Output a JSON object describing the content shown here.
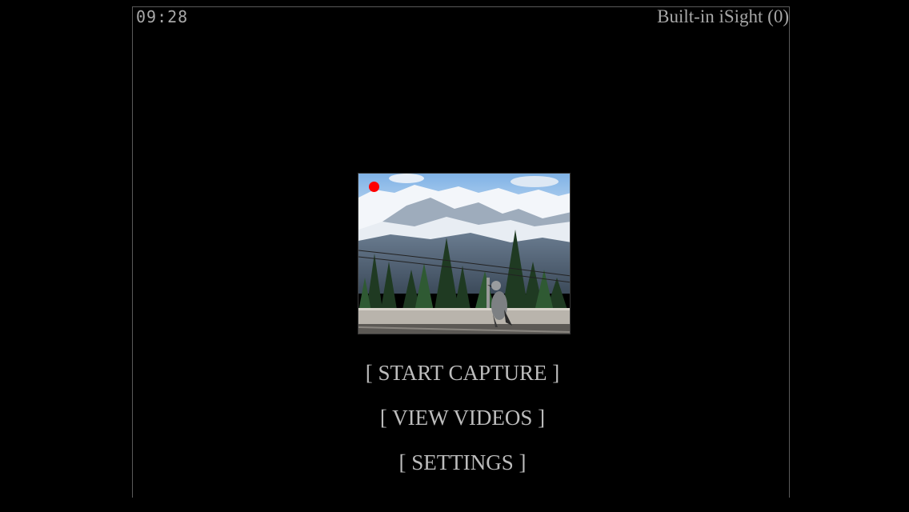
{
  "status": {
    "time": "09:28",
    "camera": "Built-in iSight (0)"
  },
  "preview": {
    "recording_indicator_color": "#ff0000",
    "icon": "camera-preview-image"
  },
  "menu": {
    "start_capture": "[ START CAPTURE ]",
    "view_videos": "[ VIEW VIDEOS ]",
    "settings": "[ SETTINGS ]"
  },
  "colors": {
    "background": "#000000",
    "text": "#bdbdbd",
    "frame": "#5a5a5a"
  }
}
